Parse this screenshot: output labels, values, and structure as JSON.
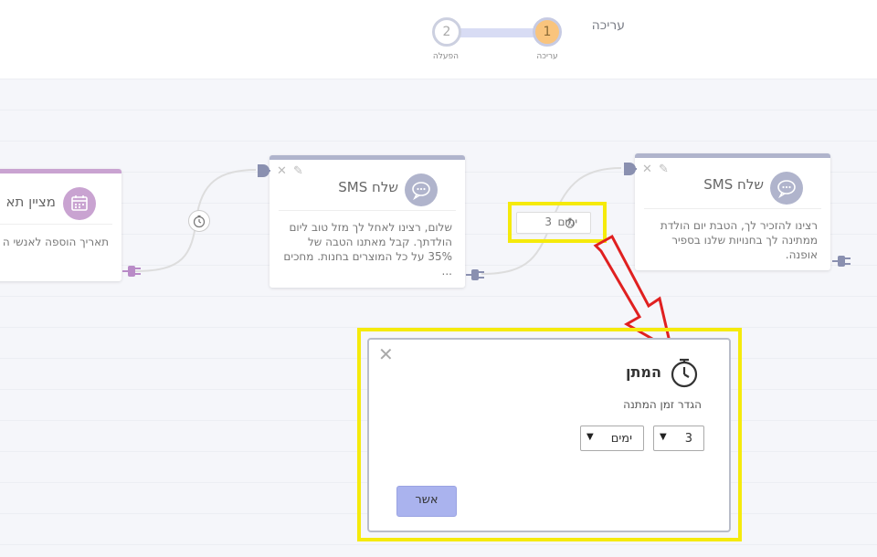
{
  "header": {
    "title": "עריכה",
    "steps": [
      {
        "number": "1",
        "label": "עריכה",
        "active": true
      },
      {
        "number": "2",
        "label": "הפעלה",
        "active": false
      }
    ]
  },
  "cards": [
    {
      "title": "מציין תא",
      "body": "תאריך הוספה לאנשי ה",
      "icon": "calendar-icon",
      "color": "#c9a3d1"
    },
    {
      "title": "שלח SMS",
      "body": "שלום, רצינו לאחל לך מזל טוב ליום הולדתך. קבל מאתנו הטבה של 35% על כל המוצרים בחנות. מחכים ...",
      "icon": "chat-icon",
      "color": "#b0b4cc"
    },
    {
      "title": "שלח SMS",
      "body": "רצינו להזכיר לך, הטבת יום הולדת ממתינה לך בחנויות שלנו בספיר אופנה.",
      "icon": "chat-icon",
      "color": "#b0b4cc"
    }
  ],
  "wait_badge": {
    "value": "3",
    "unit": "ימים"
  },
  "modal": {
    "title": "המתן",
    "subtitle": "הגדר זמן המתנה",
    "amount": "3",
    "unit": "ימים",
    "confirm": "אשר",
    "close": "✕"
  },
  "colors": {
    "highlight": "#f5ea0b",
    "accent": "#aab3ee",
    "arrow": "#e02020"
  }
}
